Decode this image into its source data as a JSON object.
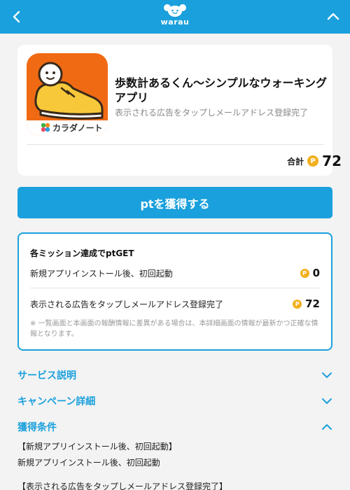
{
  "header": {
    "logo_text": "warau",
    "brand_color": "#1aa0dc",
    "back_icon": "chevron-left-icon",
    "collapse_icon": "chevron-up-icon"
  },
  "app": {
    "title": "歩数計あるくん〜シンプルなウォーキングアプリ",
    "subtitle": "表示される広告をタップしメールアドレス登録完了",
    "icon_brand": "カラダノート",
    "icon_color": "#f06a14",
    "total_label": "合計",
    "total_value": "72"
  },
  "cta": {
    "label": "ptを獲得する"
  },
  "missions": {
    "title": "各ミッション達成でptGET",
    "items": [
      {
        "label": "新規アプリインストール後、初回起動",
        "points": "0"
      },
      {
        "label": "表示される広告をタップしメールアドレス登録完了",
        "points": "72"
      }
    ],
    "note": "※ 一覧画面と本画面の報酬情報に差異がある場合は、本詳細画面の情報が最新かつ正確な情報となります。"
  },
  "accordions": [
    {
      "label": "サービス説明",
      "state": "collapsed"
    },
    {
      "label": "キャンペーン詳細",
      "state": "collapsed"
    },
    {
      "label": "獲得条件",
      "state": "expanded"
    }
  ],
  "conditions": [
    "【新規アプリインストール後、初回起動】",
    "新規アプリインストール後、初回起動",
    "【表示される広告をタップしメールアドレス登録完了】"
  ],
  "point_symbol": "P",
  "coin_color": "#f2b01e"
}
